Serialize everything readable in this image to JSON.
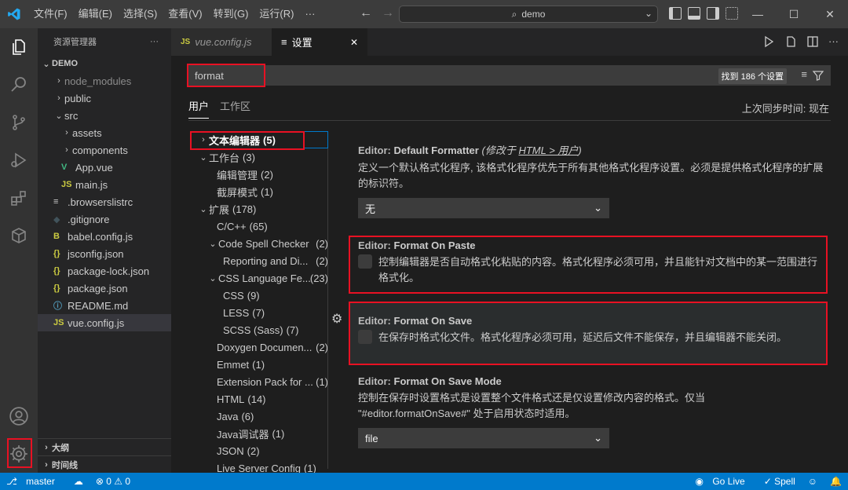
{
  "menu": [
    "文件(F)",
    "编辑(E)",
    "选择(S)",
    "查看(V)",
    "转到(G)",
    "运行(R)",
    "···"
  ],
  "command_center": "demo",
  "window_controls": [
    "—",
    "☐",
    "✕"
  ],
  "sidebar": {
    "title": "资源管理器",
    "more": "···",
    "root": "DEMO",
    "items": [
      {
        "label": "node_modules",
        "icon": "chevron-right"
      },
      {
        "label": "public",
        "icon": "chevron-right"
      },
      {
        "label": "src",
        "icon": "chevron-down"
      },
      {
        "label": "assets",
        "icon": "chevron-right"
      },
      {
        "label": "components",
        "icon": "chevron-right"
      },
      {
        "label": "App.vue",
        "icon": "vue-icon",
        "glyph": "V",
        "color": "#41b883"
      },
      {
        "label": "main.js",
        "icon": "js-icon",
        "glyph": "JS",
        "color": "#cbcb41"
      },
      {
        "label": ".browserslistrc",
        "icon": "file-icon",
        "glyph": "≡",
        "color": "#cccccc"
      },
      {
        "label": ".gitignore",
        "icon": "git-icon",
        "glyph": "◆",
        "color": "#41535b"
      },
      {
        "label": "babel.config.js",
        "icon": "babel-icon",
        "glyph": "B",
        "color": "#cbcb41"
      },
      {
        "label": "jsconfig.json",
        "icon": "json-icon",
        "glyph": "{}",
        "color": "#cbcb41"
      },
      {
        "label": "package-lock.json",
        "icon": "json-icon",
        "glyph": "{}",
        "color": "#cbcb41"
      },
      {
        "label": "package.json",
        "icon": "json-icon",
        "glyph": "{}",
        "color": "#cbcb41"
      },
      {
        "label": "README.md",
        "icon": "info-icon",
        "glyph": "ⓘ",
        "color": "#519aba"
      },
      {
        "label": "vue.config.js",
        "icon": "js-icon",
        "glyph": "JS",
        "color": "#cbcb41"
      }
    ],
    "outline": "大纲",
    "timeline": "时间线"
  },
  "tabs": [
    {
      "label": "vue.config.js",
      "icon": "JS"
    },
    {
      "label": "设置",
      "icon": "≡",
      "close": "✕"
    }
  ],
  "settings": {
    "search_value": "format",
    "found": "找到 186 个设置",
    "tab_user": "用户",
    "tab_workspace": "工作区",
    "sync": "上次同步时间: 现在",
    "toc": [
      {
        "label": "文本编辑器",
        "count": "(5)"
      },
      {
        "label": "工作台",
        "count": "(3)"
      },
      {
        "label": "编辑管理",
        "count": "(2)"
      },
      {
        "label": "截屏模式",
        "count": "(1)"
      },
      {
        "label": "扩展",
        "count": "(178)"
      },
      {
        "label": "C/C++",
        "count": "(65)"
      },
      {
        "label": "Code Spell Checker",
        "count": "(2)"
      },
      {
        "label": "Reporting and Di...",
        "count": "(2)"
      },
      {
        "label": "CSS Language Fe...",
        "count": "(23)"
      },
      {
        "label": "CSS",
        "count": "(9)"
      },
      {
        "label": "LESS",
        "count": "(7)"
      },
      {
        "label": "SCSS (Sass)",
        "count": "(7)"
      },
      {
        "label": "Doxygen Documen...",
        "count": "(2)"
      },
      {
        "label": "Emmet",
        "count": "(1)"
      },
      {
        "label": "Extension Pack for ...",
        "count": "(1)"
      },
      {
        "label": "HTML",
        "count": "(14)"
      },
      {
        "label": "Java",
        "count": "(6)"
      },
      {
        "label": "Java调试器",
        "count": "(1)"
      },
      {
        "label": "JSON",
        "count": "(2)"
      },
      {
        "label": "Live Server Config",
        "count": "(1)"
      }
    ],
    "default_formatter": {
      "category": "Editor: ",
      "title": "Default Formatter",
      "mod_prefix": "(修改于 ",
      "mod_link": "HTML > 用户",
      "mod_suffix": ")",
      "desc": "定义一个默认格式化程序, 该格式化程序优先于所有其他格式化程序设置。必须是提供格式化程序的扩展的标识符。",
      "value": "无"
    },
    "format_on_paste": {
      "category": "Editor: ",
      "title": "Format On Paste",
      "desc": "控制编辑器是否自动格式化粘贴的内容。格式化程序必须可用，并且能针对文档中的某一范围进行格式化。"
    },
    "format_on_save": {
      "category": "Editor: ",
      "title": "Format On Save",
      "desc": "在保存时格式化文件。格式化程序必须可用，延迟后文件不能保存，并且编辑器不能关闭。"
    },
    "format_on_save_mode": {
      "category": "Editor: ",
      "title": "Format On Save Mode",
      "desc": "控制在保存时设置格式是设置整个文件格式还是仅设置修改内容的格式。仅当 \"#editor.formatOnSave#\" 处于启用状态时适用。",
      "value": "file"
    }
  },
  "status": {
    "branch": "master",
    "problems": "⊗ 0 ⚠ 0",
    "golive": "Go Live",
    "spell": "✓ Spell"
  },
  "colors": {
    "accent": "#007acc",
    "highlight": "#e81123"
  }
}
